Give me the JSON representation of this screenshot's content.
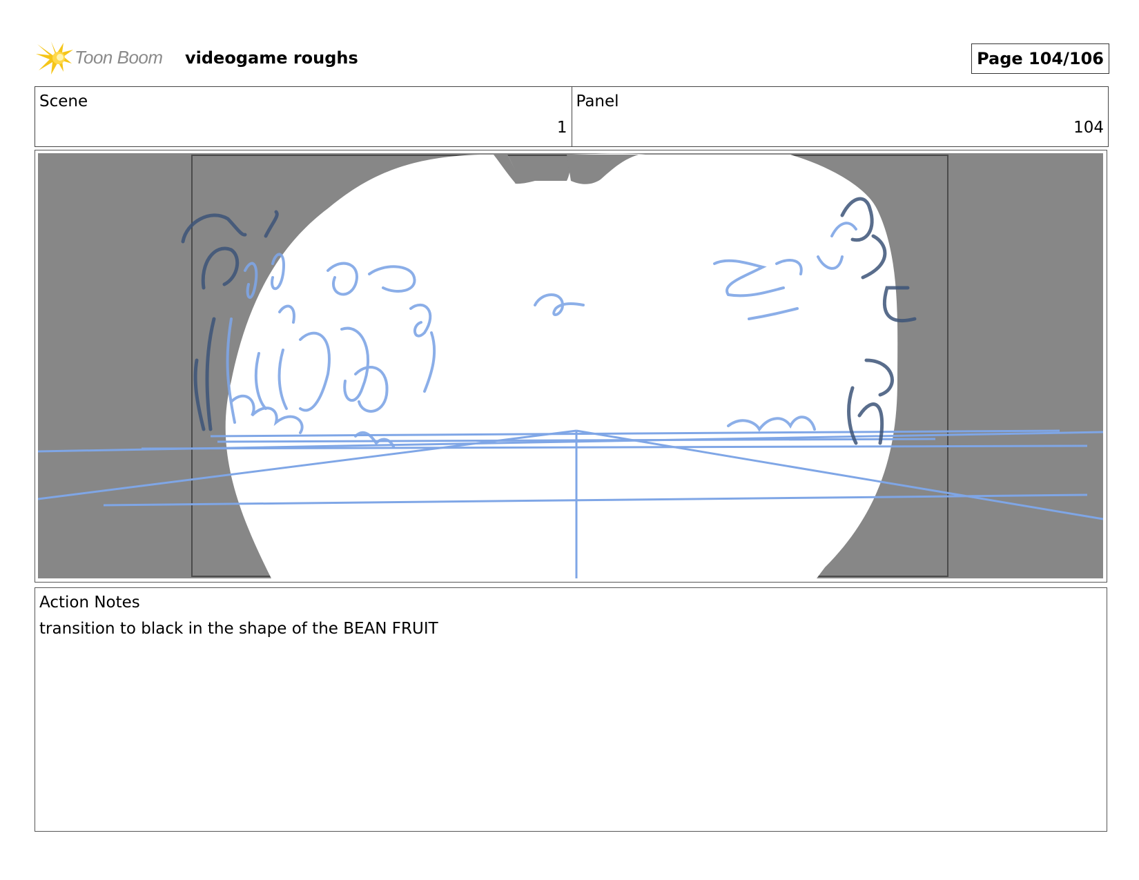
{
  "header": {
    "logo_text": "Toon Boom",
    "project_title": "videogame roughs",
    "page_label": "Page 104/106"
  },
  "info": {
    "scene_label": "Scene",
    "scene_value": "1",
    "panel_label": "Panel",
    "panel_value": "104"
  },
  "panel_image": {
    "description_icon": "bean-fruit-sketch",
    "background_color": "#878787",
    "sketch_color": "#7fa6e6",
    "dark_stroke_color": "#3d5478"
  },
  "notes": {
    "label": "Action Notes",
    "text": "transition to black in the shape of the BEAN FRUIT"
  }
}
